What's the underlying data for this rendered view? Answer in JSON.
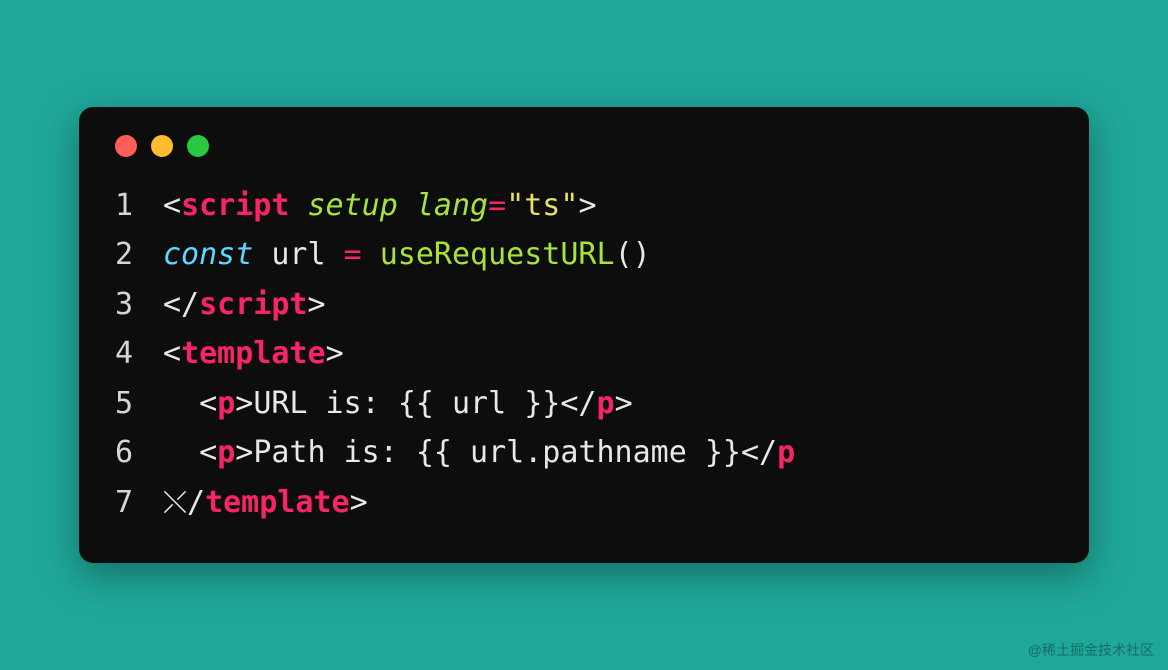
{
  "watermark": "@稀土掘金技术社区",
  "colors": {
    "background": "#1fa89a",
    "window": "#0d0d0d",
    "traffic_red": "#ff5f57",
    "traffic_yellow": "#febc2e",
    "traffic_green": "#28c840",
    "tag": "#f72565",
    "attr": "#a7e33d",
    "string": "#e8e060",
    "keyword": "#5ed7ff",
    "text": "#e8e8e8"
  },
  "code": {
    "lines": [
      {
        "n": "1",
        "tokens": [
          {
            "t": "bracket",
            "v": "<"
          },
          {
            "t": "tag",
            "v": "script"
          },
          {
            "t": "text",
            "v": " "
          },
          {
            "t": "attr",
            "v": "setup"
          },
          {
            "t": "text",
            "v": " "
          },
          {
            "t": "attr",
            "v": "lang"
          },
          {
            "t": "eq",
            "v": "="
          },
          {
            "t": "string",
            "v": "\"ts\""
          },
          {
            "t": "bracket",
            "v": ">"
          }
        ]
      },
      {
        "n": "2",
        "tokens": [
          {
            "t": "keyword",
            "v": "const"
          },
          {
            "t": "text",
            "v": " "
          },
          {
            "t": "var",
            "v": "url"
          },
          {
            "t": "text",
            "v": " "
          },
          {
            "t": "op",
            "v": "="
          },
          {
            "t": "text",
            "v": " "
          },
          {
            "t": "func",
            "v": "useRequestURL"
          },
          {
            "t": "paren",
            "v": "()"
          }
        ]
      },
      {
        "n": "3",
        "tokens": [
          {
            "t": "bracket",
            "v": "</"
          },
          {
            "t": "tag",
            "v": "script"
          },
          {
            "t": "bracket",
            "v": ">"
          }
        ]
      },
      {
        "n": "4",
        "tokens": [
          {
            "t": "bracket",
            "v": "<"
          },
          {
            "t": "tag",
            "v": "template"
          },
          {
            "t": "bracket",
            "v": ">"
          }
        ]
      },
      {
        "n": "5",
        "tokens": [
          {
            "t": "text",
            "v": "  "
          },
          {
            "t": "bracket",
            "v": "<"
          },
          {
            "t": "tag",
            "v": "p"
          },
          {
            "t": "bracket",
            "v": ">"
          },
          {
            "t": "text",
            "v": "URL is: "
          },
          {
            "t": "interp",
            "v": "{{ url }}"
          },
          {
            "t": "bracket",
            "v": "</"
          },
          {
            "t": "tag",
            "v": "p"
          },
          {
            "t": "bracket",
            "v": ">"
          }
        ]
      },
      {
        "n": "6",
        "tokens": [
          {
            "t": "text",
            "v": "  "
          },
          {
            "t": "bracket",
            "v": "<"
          },
          {
            "t": "tag",
            "v": "p"
          },
          {
            "t": "bracket",
            "v": ">"
          },
          {
            "t": "text",
            "v": "Path is: "
          },
          {
            "t": "interp",
            "v": "{{ url"
          },
          {
            "t": "prop",
            "v": ".pathname }}"
          },
          {
            "t": "bracket",
            "v": "</"
          },
          {
            "t": "tag",
            "v": "p"
          }
        ]
      },
      {
        "n": "7",
        "tokens": [
          {
            "t": "bracket",
            "v": "⤬/"
          },
          {
            "t": "tag",
            "v": "template"
          },
          {
            "t": "bracket",
            "v": ">"
          }
        ]
      }
    ]
  }
}
